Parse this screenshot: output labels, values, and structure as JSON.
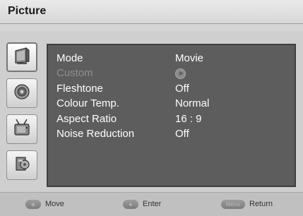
{
  "window": {
    "title": "Picture"
  },
  "sidebar": {
    "icons": [
      {
        "name": "picture-icon",
        "active": true
      },
      {
        "name": "sound-icon",
        "active": false
      },
      {
        "name": "channel-icon",
        "active": false
      },
      {
        "name": "setup-icon",
        "active": false
      }
    ]
  },
  "menu": {
    "rows": [
      {
        "label": "Mode",
        "value": "Movie",
        "enabled": true
      },
      {
        "label": "Custom",
        "value": "",
        "enabled": false,
        "value_icon": "play-circle-icon"
      },
      {
        "label": "Fleshtone",
        "value": "Off",
        "enabled": true
      },
      {
        "label": "Colour Temp.",
        "value": "Normal",
        "enabled": true
      },
      {
        "label": "Aspect Ratio",
        "value": "16 : 9",
        "enabled": true
      },
      {
        "label": "Noise Reduction",
        "value": "Off",
        "enabled": true
      }
    ]
  },
  "footer": {
    "move": {
      "key_icon": "dpad-icon",
      "label": "Move"
    },
    "enter": {
      "key_icon": "enter-key-icon",
      "label": "Enter"
    },
    "return": {
      "key_label": "Menu",
      "label": "Return"
    }
  },
  "colors": {
    "panel_bg": "#5d5d5d",
    "text_enabled": "#ffffff",
    "text_disabled": "#8e8e8e",
    "chrome_bg": "#cfcfcf"
  }
}
